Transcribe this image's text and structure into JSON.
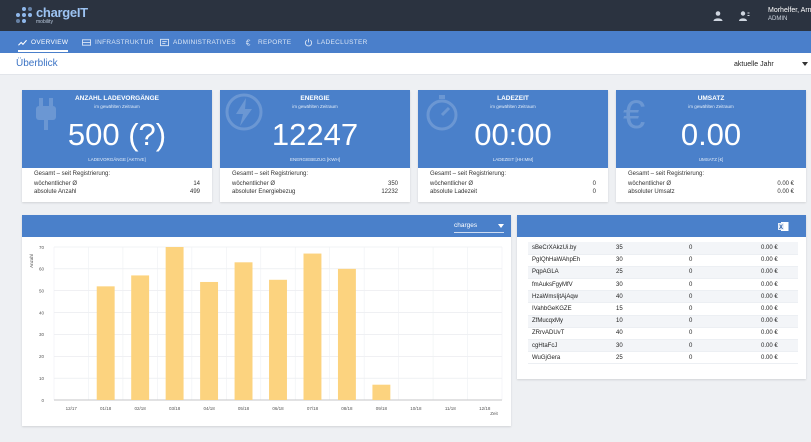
{
  "app": {
    "brand": "chargeIT",
    "brand_sub": "mobility"
  },
  "user": {
    "name": "Morhelfer, Arno",
    "role": "ADMIN"
  },
  "nav": [
    {
      "label": "OVERVIEW",
      "icon": "trend-icon",
      "active": true
    },
    {
      "label": "INFRASTRUKTUR",
      "icon": "infrastructure-icon",
      "active": false
    },
    {
      "label": "ADMINISTRATIVES",
      "icon": "admin-icon",
      "active": false
    },
    {
      "label": "REPORTE",
      "icon": "euro-icon",
      "active": false
    },
    {
      "label": "LADECLUSTER",
      "icon": "power-icon",
      "active": false
    }
  ],
  "page": {
    "title": "Überblick",
    "period_select": "aktuelle Jahr"
  },
  "cards": [
    {
      "title": "ANZAHL LADEVORGÄNGE",
      "subtitle": "im gewählten Zeitraum",
      "value": "500 (?)",
      "label": "LADEVORGÄNGE [AKTIVE]",
      "footer_head": "Gesamt – seit Registrierung:",
      "row1_label": "wöchentlicher Ø",
      "row1_value": "14",
      "row2_label": "absolute Anzahl",
      "row2_value": "499",
      "bg_icon": "plug-icon"
    },
    {
      "title": "ENERGIE",
      "subtitle": "im gewählten Zeitraum",
      "value": "12247",
      "label": "ENERGIEBEZUG [KWH]",
      "footer_head": "Gesamt – seit Registrierung:",
      "row1_label": "wöchentlicher Ø",
      "row1_value": "350",
      "row2_label": "absoluter Energiebezug",
      "row2_value": "12232",
      "bg_icon": "lightning-icon"
    },
    {
      "title": "LADEZEIT",
      "subtitle": "im gewählten Zeitraum",
      "value": "00:00",
      "label": "LADEZEIT [HH:MM]",
      "footer_head": "Gesamt – seit Registrierung:",
      "row1_label": "wöchentlicher Ø",
      "row1_value": "0",
      "row2_label": "absolute Ladezeit",
      "row2_value": "0",
      "bg_icon": "stopwatch-icon"
    },
    {
      "title": "UMSATZ",
      "subtitle": "im gewählten Zeitraum",
      "value": "0.00",
      "label": "UMSATZ [€]",
      "footer_head": "Gesamt – seit Registrierung:",
      "row1_label": "wöchentlicher Ø",
      "row1_value": "0.00 €",
      "row2_label": "absoluter Umsatz",
      "row2_value": "0.00 €",
      "bg_icon": "euro-icon"
    }
  ],
  "chart_panel": {
    "select": "charges"
  },
  "chart_data": {
    "type": "bar",
    "categories": [
      "12/17",
      "01/18",
      "02/18",
      "03/18",
      "04/18",
      "05/18",
      "06/18",
      "07/18",
      "08/18",
      "09/18",
      "10/18",
      "11/18",
      "12/18"
    ],
    "values": [
      0,
      52,
      57,
      70,
      54,
      63,
      55,
      67,
      60,
      7,
      0,
      0,
      0
    ],
    "ylabel": "Anzahl",
    "xlabel": "Zeit",
    "ylim": [
      0,
      70
    ],
    "yticks": [
      0,
      10,
      20,
      30,
      40,
      50,
      60,
      70
    ],
    "grid": true,
    "bar_color": "#fcd37f"
  },
  "table": {
    "rows": [
      [
        "sBeCrXAkzUi.by",
        "35",
        "0",
        "0.00 €"
      ],
      [
        "PgIQhHaWAhpEh",
        "30",
        "0",
        "0.00 €"
      ],
      [
        "PqpAGLA",
        "25",
        "0",
        "0.00 €"
      ],
      [
        "fmAuksFgyMfV",
        "30",
        "0",
        "0.00 €"
      ],
      [
        "HzaWmsIjtAjAqw",
        "40",
        "0",
        "0.00 €"
      ],
      [
        "IVahbGeKGZE",
        "15",
        "0",
        "0.00 €"
      ],
      [
        "ZfMucqxMy",
        "10",
        "0",
        "0.00 €"
      ],
      [
        "ZRrvADUvT",
        "40",
        "0",
        "0.00 €"
      ],
      [
        "cgHtaFcJ",
        "30",
        "0",
        "0.00 €"
      ],
      [
        "WuGjGera",
        "25",
        "0",
        "0.00 €"
      ]
    ]
  },
  "colors": {
    "topbar": "#2b3340",
    "primary": "#4a80ca",
    "bar": "#fcd37f"
  }
}
